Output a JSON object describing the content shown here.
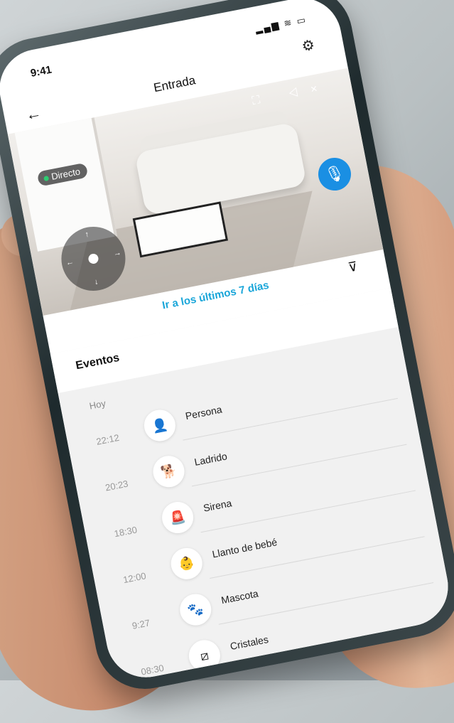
{
  "status": {
    "time": "9:41",
    "icons": "▂▄▆ ≋ ▭"
  },
  "nav": {
    "back_icon": "←",
    "title": "Entrada",
    "settings_icon": "⚙"
  },
  "camera": {
    "live_label": "Directo",
    "icons": "⛶ ◁×",
    "mic_icon": "🎙"
  },
  "controls": {
    "last_days_link": "Ir a los últimos 7 días",
    "filter_icon": "⊽"
  },
  "events": {
    "header": "Eventos",
    "day": "Hoy",
    "items": [
      {
        "time": "22:12",
        "label": "Persona",
        "icon": "person-icon",
        "glyph": "👤"
      },
      {
        "time": "20:23",
        "label": "Ladrido",
        "icon": "dog-bark-icon",
        "glyph": "🐕"
      },
      {
        "time": "18:30",
        "label": "Sirena",
        "icon": "siren-icon",
        "glyph": "🚨"
      },
      {
        "time": "12:00",
        "label": "Llanto de bebé",
        "icon": "baby-icon",
        "glyph": "👶"
      },
      {
        "time": "9:27",
        "label": "Mascota",
        "icon": "paw-icon",
        "glyph": "🐾"
      },
      {
        "time": "08:30",
        "label": "Cristales",
        "icon": "glass-break-icon",
        "glyph": "⧄"
      }
    ]
  }
}
